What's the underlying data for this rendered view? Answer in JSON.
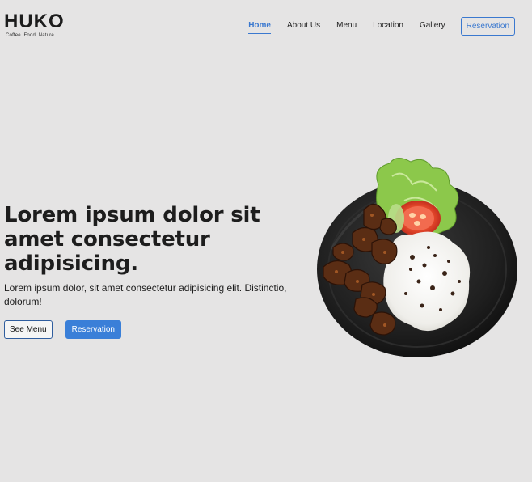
{
  "brand": {
    "name": "HUKO",
    "tagline": "Coffee. Food. Nature"
  },
  "nav": {
    "items": [
      {
        "label": "Home",
        "active": true
      },
      {
        "label": "About Us",
        "active": false
      },
      {
        "label": "Menu",
        "active": false
      },
      {
        "label": "Location",
        "active": false
      },
      {
        "label": "Gallery",
        "active": false
      }
    ],
    "reservation_label": "Reservation"
  },
  "hero": {
    "title": "Lorem ipsum dolor sit amet consectetur adipisicing.",
    "subtitle": "Lorem ipsum dolor, sit amet consectetur adipisicing elit. Distinctio, dolorum!",
    "see_menu_label": "See Menu",
    "reservation_label": "Reservation",
    "image": "plate of rice with grilled meat, lettuce and tomato"
  },
  "colors": {
    "background": "#e5e4e4",
    "accent": "#3a78cf",
    "primary_button": "#3a7fd8",
    "text": "#1d1d1d"
  }
}
